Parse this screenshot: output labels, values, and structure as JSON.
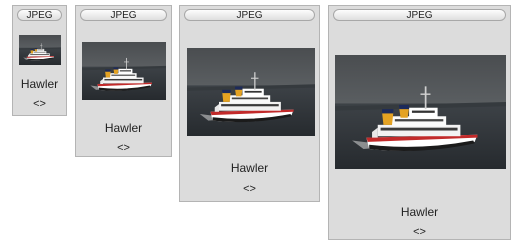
{
  "cards": [
    {
      "type_label": "JPEG",
      "title": "Hawler",
      "arrows": "<>",
      "thumbnail": "ferry-photo"
    },
    {
      "type_label": "JPEG",
      "title": "Hawler",
      "arrows": "<>",
      "thumbnail": "ferry-photo"
    },
    {
      "type_label": "JPEG",
      "title": "Hawler",
      "arrows": "<>",
      "thumbnail": "ferry-photo"
    },
    {
      "type_label": "JPEG",
      "title": "Hawler",
      "arrows": "<>",
      "thumbnail": "ferry-photo"
    }
  ],
  "colors": {
    "card_background": "#dcdcdc",
    "card_border": "#b4b4b4",
    "text": "#222222"
  }
}
